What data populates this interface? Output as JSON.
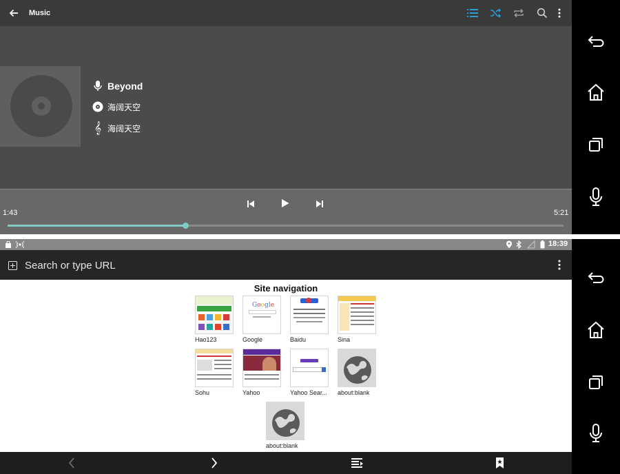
{
  "music": {
    "title": "Music",
    "artist": "Beyond",
    "album": "海阔天空",
    "song": "海阔天空",
    "time_elapsed": "1:43",
    "time_total": "5:21",
    "progress": 0.32,
    "toolbar_icons": [
      "back-arrow-icon",
      "playlist-icon",
      "shuffle-icon",
      "repeat-icon",
      "search-icon",
      "overflow-menu-icon"
    ],
    "accent_color": "#2a9fd8",
    "progress_color": "#7fcdc6"
  },
  "statusbar": {
    "time": "18:39"
  },
  "browser": {
    "url_placeholder": "Search or type URL",
    "section_title": "Site navigation",
    "tiles": [
      {
        "label": "Hao123"
      },
      {
        "label": "Google"
      },
      {
        "label": "Baidu"
      },
      {
        "label": "Sina"
      },
      {
        "label": "Sohu"
      },
      {
        "label": "Yahoo"
      },
      {
        "label": "Yahoo Sear..."
      },
      {
        "label": "about:blank"
      },
      {
        "label": "about:blank"
      }
    ]
  },
  "navbar_icons": [
    "back-icon",
    "home-icon",
    "recents-icon",
    "mic-icon"
  ]
}
